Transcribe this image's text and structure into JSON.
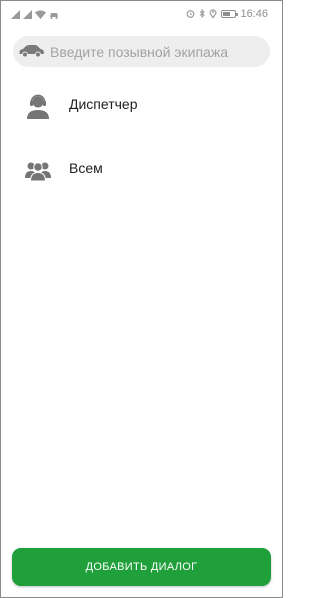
{
  "status_bar": {
    "time": "16:46",
    "left_icons": [
      "signal-icon",
      "signal-icon",
      "wifi-icon",
      "notification-icon"
    ],
    "right_icons": [
      "alarm-icon",
      "bluetooth-icon",
      "location-icon",
      "battery-icon"
    ]
  },
  "search": {
    "placeholder": "Введите позывной экипажа",
    "value": "",
    "icon": "car-icon"
  },
  "list": {
    "items": [
      {
        "label": "Диспетчер",
        "icon": "headset-person-icon"
      },
      {
        "label": "Всем",
        "icon": "group-icon"
      }
    ]
  },
  "footer": {
    "add_button_label": "ДОБАВИТЬ ДИАЛОГ"
  },
  "colors": {
    "accent": "#1fa03a",
    "icon_gray": "#757575",
    "search_bg": "#eeeeee",
    "placeholder": "#a3a3a3"
  }
}
